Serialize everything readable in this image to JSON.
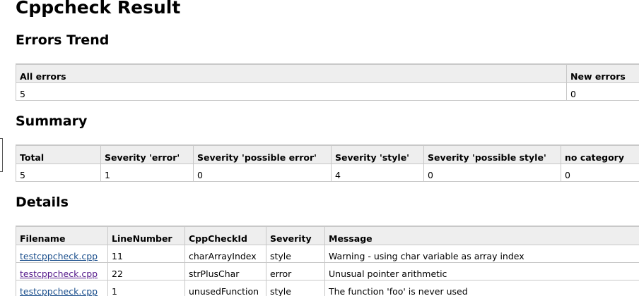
{
  "title": "Cppcheck Result",
  "trend": {
    "heading": "Errors Trend",
    "headers": [
      "All errors",
      "New errors"
    ],
    "row": [
      "5",
      "0"
    ]
  },
  "summary": {
    "heading": "Summary",
    "headers": [
      "Total",
      "Severity 'error'",
      "Severity 'possible error'",
      "Severity 'style'",
      "Severity 'possible style'",
      "no category"
    ],
    "row": [
      "5",
      "1",
      "0",
      "4",
      "0",
      "0"
    ]
  },
  "details": {
    "heading": "Details",
    "headers": [
      "Filename",
      "LineNumber",
      "CppCheckId",
      "Severity",
      "Message"
    ],
    "rows": [
      {
        "filename": "testcppcheck.cpp",
        "line": "11",
        "id": "charArrayIndex",
        "severity": "style",
        "message": "Warning - using char variable as array index"
      },
      {
        "filename": "testcppcheck.cpp",
        "line": "22",
        "id": "strPlusChar",
        "severity": "error",
        "message": "Unusual pointer arithmetic"
      },
      {
        "filename": "testcppcheck.cpp",
        "line": "1",
        "id": "unusedFunction",
        "severity": "style",
        "message": "The function 'foo' is never used"
      }
    ]
  },
  "colors": {
    "link": "#1a4e8c",
    "visited_link": "#551a8b",
    "header_bg": "#eeeeee",
    "border": "#c8c8c8"
  }
}
